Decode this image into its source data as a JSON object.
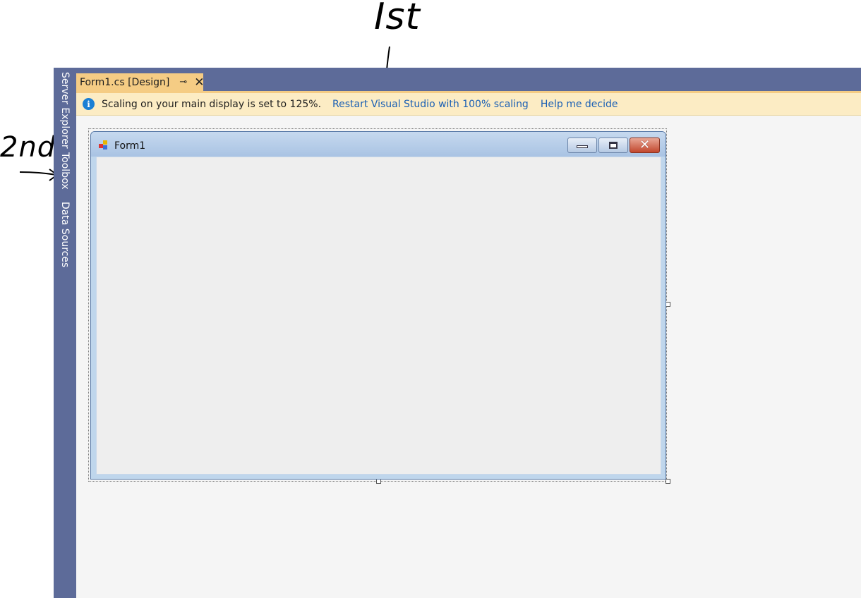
{
  "annotations": {
    "first_label": "Ist",
    "second_label": "2nd"
  },
  "side_tabs": [
    {
      "label": "Server Explorer"
    },
    {
      "label": "Toolbox"
    },
    {
      "label": "Data Sources"
    }
  ],
  "document_tab": {
    "title": "Form1.cs [Design]",
    "pin_icon": "⊸",
    "close_icon": "✕"
  },
  "infobar": {
    "icon": "i",
    "message": "Scaling on your main display is set to 125%.",
    "restart_link": "Restart Visual Studio with 100% scaling",
    "help_link": "Help me decide"
  },
  "form": {
    "title": "Form1",
    "close_glyph": "✕"
  },
  "colors": {
    "strip": "#5d6b99",
    "tab_active": "#f5cc84",
    "infobar": "#fcecc4",
    "link": "#1a5fb4"
  }
}
